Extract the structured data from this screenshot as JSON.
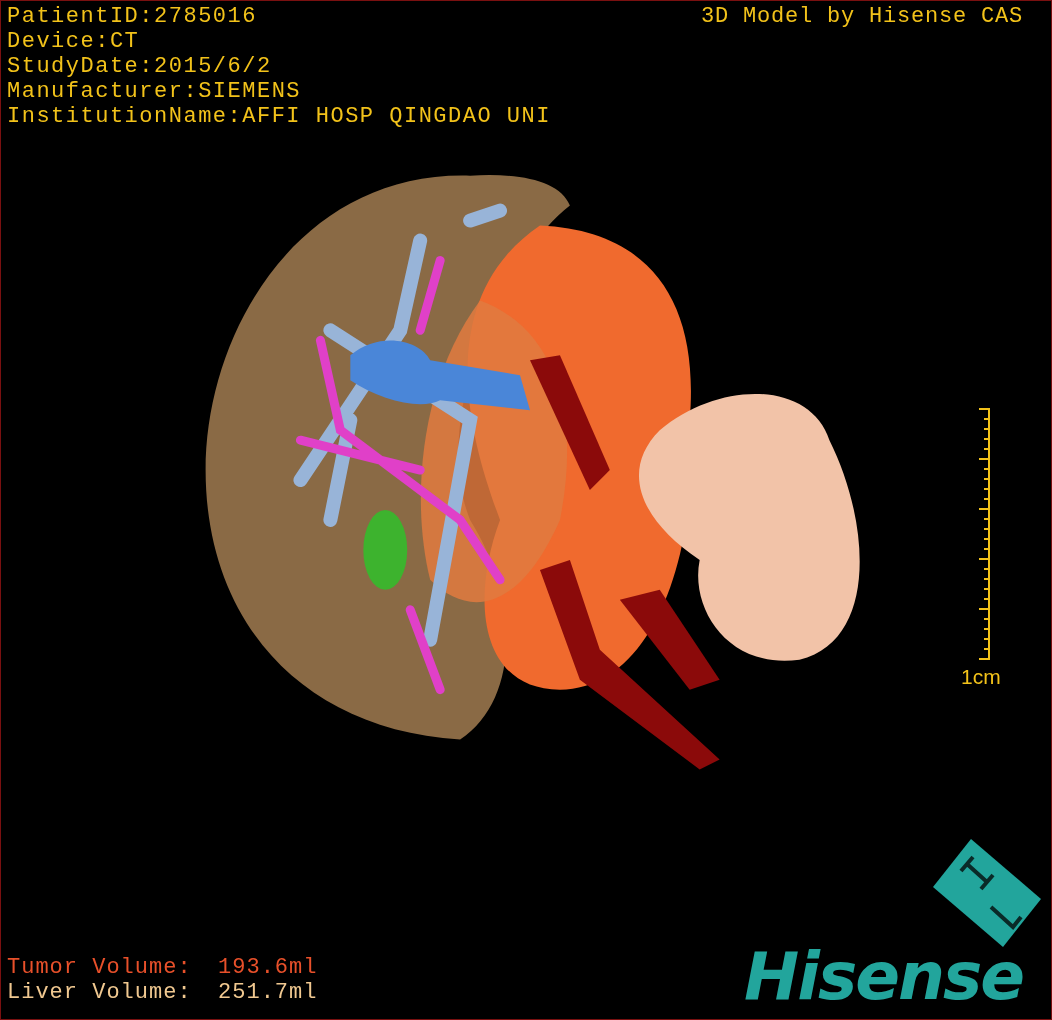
{
  "info_lines": [
    "PatientID:2785016",
    "Device:CT",
    "StudyDate:2015/6/2",
    "Manufacturer:SIEMENS",
    "InstitutionName:AFFI HOSP QINGDAO UNI"
  ],
  "title": "3D Model by Hisense CAS",
  "scale_bar": {
    "label": "1cm"
  },
  "volumes": [
    {
      "kind": "tumor",
      "label": "Tumor Volume:",
      "value": "193.6ml"
    },
    {
      "kind": "liver",
      "label": "Liver Volume:",
      "value": "251.7ml"
    }
  ],
  "brand": "Hisense"
}
